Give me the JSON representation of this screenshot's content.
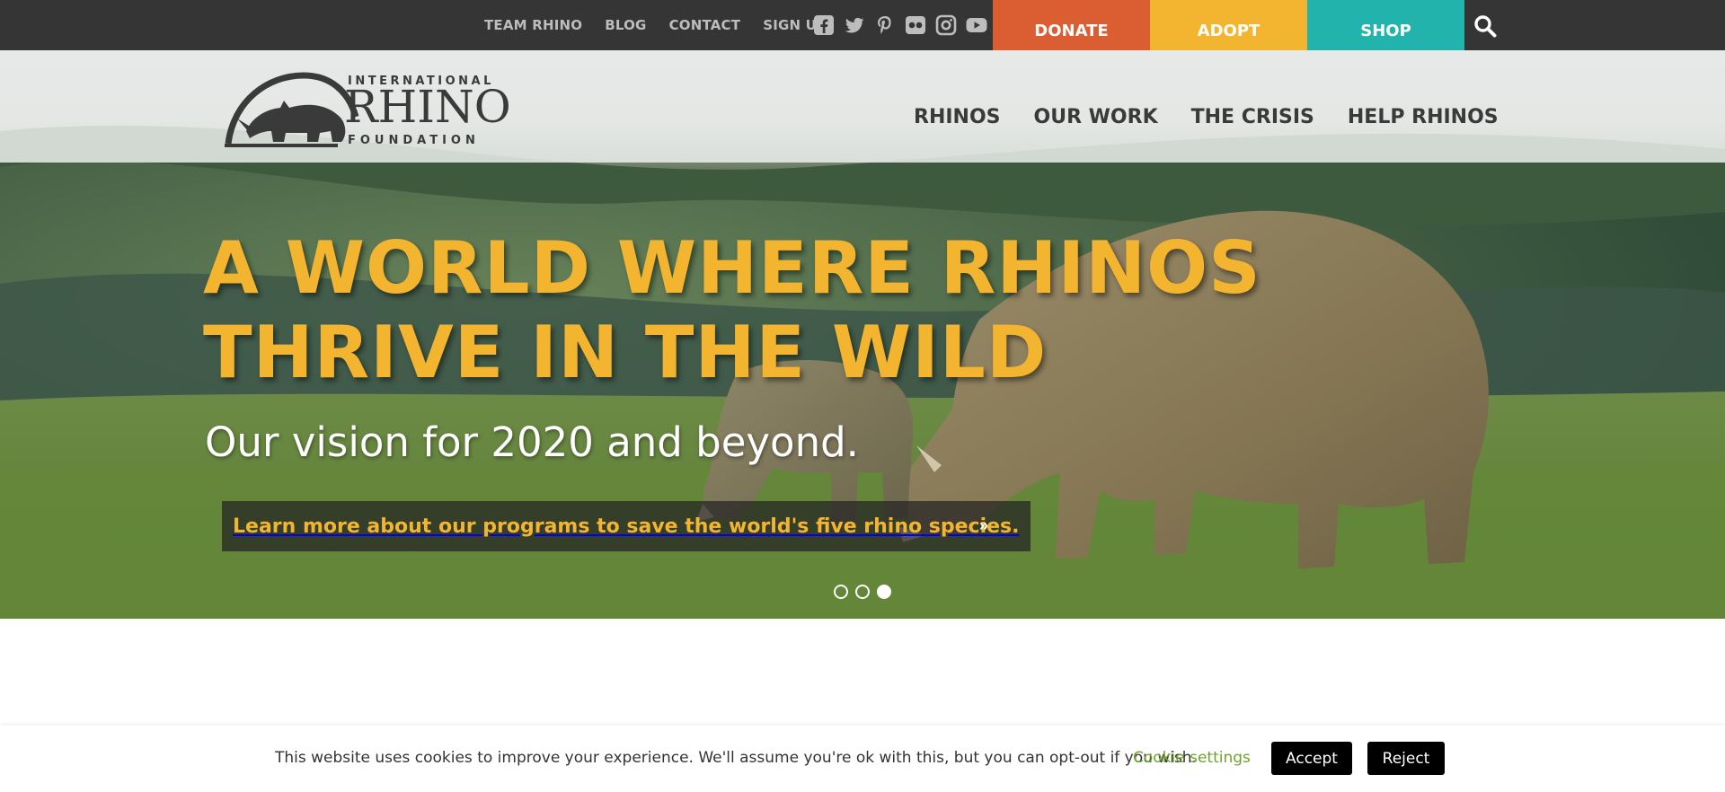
{
  "topbar": {
    "links": [
      "TEAM RHINO",
      "BLOG",
      "CONTACT",
      "SIGN UP"
    ],
    "social_icons": [
      "facebook-icon",
      "twitter-icon",
      "pinterest-icon",
      "flickr-icon",
      "instagram-icon",
      "youtube-icon"
    ],
    "cta": {
      "donate": "DONATE",
      "adopt": "ADOPT",
      "shop": "SHOP"
    },
    "colors": {
      "bar": "#353535",
      "donate": "#db5e32",
      "adopt": "#f3b52f",
      "shop": "#23b3ad"
    }
  },
  "logo": {
    "line1": "INTERNATIONAL",
    "line2": "RHINO",
    "line3": "FOUNDATION"
  },
  "nav": {
    "items": [
      "RHINOS",
      "OUR WORK",
      "THE CRISIS",
      "HELP RHINOS"
    ]
  },
  "hero": {
    "headline_line1": "A WORLD WHERE RHINOS",
    "headline_line2": "THRIVE IN THE WILD",
    "subhead": "Our vision for 2020 and beyond.",
    "link_text": "Learn more about our programs to save the world's five rhino species.",
    "link_arrow": "»",
    "slides_total": 3,
    "slide_active": 3,
    "accent": "#f3b52f"
  },
  "cookie": {
    "message": "This website uses cookies to improve your experience. We'll assume you're ok with this, but you can opt-out if you wish.",
    "settings_label": "Cookie settings",
    "accept_label": "Accept",
    "reject_label": "Reject"
  }
}
